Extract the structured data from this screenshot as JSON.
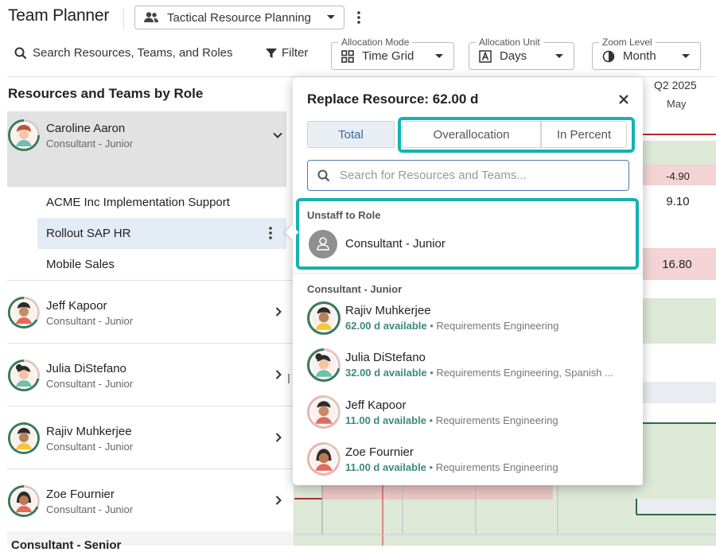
{
  "header": {
    "title": "Team Planner",
    "view_select": "Tactical Resource Planning"
  },
  "toolbar": {
    "search_label": "Search Resources, Teams, and Roles",
    "filter_label": "Filter",
    "allocation_mode": {
      "label": "Allocation Mode",
      "value": "Time Grid"
    },
    "allocation_unit": {
      "label": "Allocation Unit",
      "value": "Days"
    },
    "zoom_level": {
      "label": "Zoom Level",
      "value": "Month"
    }
  },
  "panel": {
    "title": "Resources and Teams by Role",
    "next_group": "Consultant - Senior"
  },
  "resources": [
    {
      "name": "Caroline Aaron",
      "role": "Consultant - Junior",
      "avatar": "avatar-caroline",
      "expanded": true,
      "projects": [
        "ACME Inc Implementation Support",
        "Rollout SAP HR",
        "Mobile Sales"
      ]
    },
    {
      "name": "Jeff Kapoor",
      "role": "Consultant - Junior",
      "avatar": "avatar-jeff"
    },
    {
      "name": "Julia DiStefano",
      "role": "Consultant - Junior",
      "avatar": "avatar-julia"
    },
    {
      "name": "Rajiv Muhkerjee",
      "role": "Consultant - Junior",
      "avatar": "avatar-rajiv"
    },
    {
      "name": "Zoe Fournier",
      "role": "Consultant - Junior",
      "avatar": "avatar-zoe"
    }
  ],
  "timeline": {
    "quarter": "Q2 2025",
    "month": "May",
    "caroline_total": "-4.90",
    "acme_value": "9.10",
    "mobile_value": "16.80",
    "colors": {
      "over": "#f3d3d3",
      "ok": "#dde8d7",
      "neutral": "#e9edf2",
      "line_red": "#b03030",
      "line_green": "#2f6b45"
    }
  },
  "popup": {
    "title": "Replace Resource: 62.00 d",
    "tabs": [
      "Total",
      "Overallocation",
      "In Percent"
    ],
    "search_placeholder": "Search for Resources and Teams...",
    "unstaff_label": "Unstaff to Role",
    "unstaff_role": "Consultant - Junior",
    "candidates_label": "Consultant - Junior",
    "candidates": [
      {
        "name": "Rajiv Muhkerjee",
        "available": "62.00 d available",
        "skills": "Requirements Engineering"
      },
      {
        "name": "Julia DiStefano",
        "available": "32.00 d available",
        "skills": "Requirements Engineering, Spanish ..."
      },
      {
        "name": "Jeff Kapoor",
        "available": "11.00 d available",
        "skills": "Requirements Engineering"
      },
      {
        "name": "Zoe Fournier",
        "available": "11.00 d available",
        "skills": "Requirements Engineering"
      }
    ],
    "highlight_color": "#14b3b0"
  }
}
